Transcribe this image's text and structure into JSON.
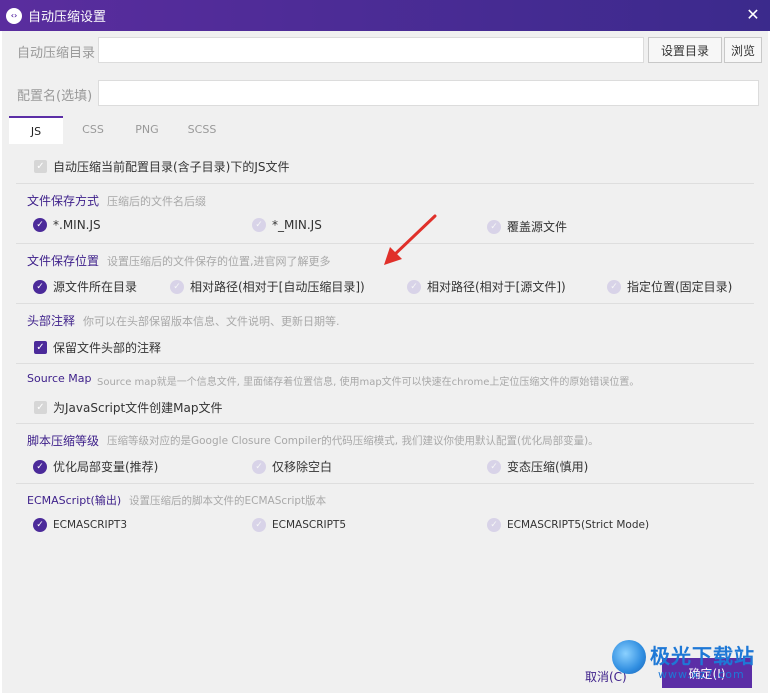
{
  "window": {
    "title": "自动压缩设置",
    "app_icon": "‹›"
  },
  "form": {
    "dir_label": "自动压缩目录",
    "dir_value": "",
    "set_dir_button": "设置目录",
    "browse_button": "浏览",
    "config_label": "配置名(选填)",
    "config_value": ""
  },
  "tabs": [
    "JS",
    "CSS",
    "PNG",
    "SCSS"
  ],
  "active_tab": "JS",
  "auto_compress": {
    "label": "自动压缩当前配置目录(含子目录)下的JS文件",
    "checked": true,
    "disabled": true
  },
  "sections": {
    "save_mode": {
      "title": "文件保存方式",
      "desc": "压缩后的文件名后缀",
      "options": [
        "*.MIN.JS",
        "*_MIN.JS",
        "覆盖源文件"
      ],
      "selected": 0
    },
    "save_location": {
      "title": "文件保存位置",
      "desc": "设置压缩后的文件保存的位置,进官网了解更多",
      "options": [
        "源文件所在目录",
        "相对路径(相对于[自动压缩目录])",
        "相对路径(相对于[源文件])",
        "指定位置(固定目录)"
      ],
      "selected": 0
    },
    "header_comment": {
      "title": "头部注释",
      "desc": "你可以在头部保留版本信息、文件说明、更新日期等.",
      "checkbox": "保留文件头部的注释",
      "checked": true
    },
    "source_map": {
      "title": "Source Map",
      "desc": "Source map就是一个信息文件, 里面储存着位置信息, 使用map文件可以快速在chrome上定位压缩文件的原始错误位置。",
      "checkbox": "为JavaScript文件创建Map文件",
      "checked": true,
      "disabled": true
    },
    "compress_level": {
      "title": "脚本压缩等级",
      "desc": "压缩等级对应的是Google Closure Compiler的代码压缩模式, 我们建议你使用默认配置(优化局部变量)。",
      "options": [
        "优化局部变量(推荐)",
        "仅移除空白",
        "变态压缩(慎用)"
      ],
      "selected": 0
    },
    "ecmascript": {
      "title": "ECMAScript(输出)",
      "desc": "设置压缩后的脚本文件的ECMAScript版本",
      "options": [
        "ECMASCRIPT3",
        "ECMASCRIPT5",
        "ECMASCRIPT5(Strict Mode)"
      ],
      "selected": 0
    }
  },
  "footer": {
    "cancel": "取消(C)",
    "ok": "确定(I)"
  },
  "watermark": {
    "name": "极光下载站",
    "url": "www.xz7.com"
  },
  "colors": {
    "accent": "#5b2ea6",
    "title_bar": "#4a2a96",
    "annotation_arrow": "#e0302a"
  }
}
